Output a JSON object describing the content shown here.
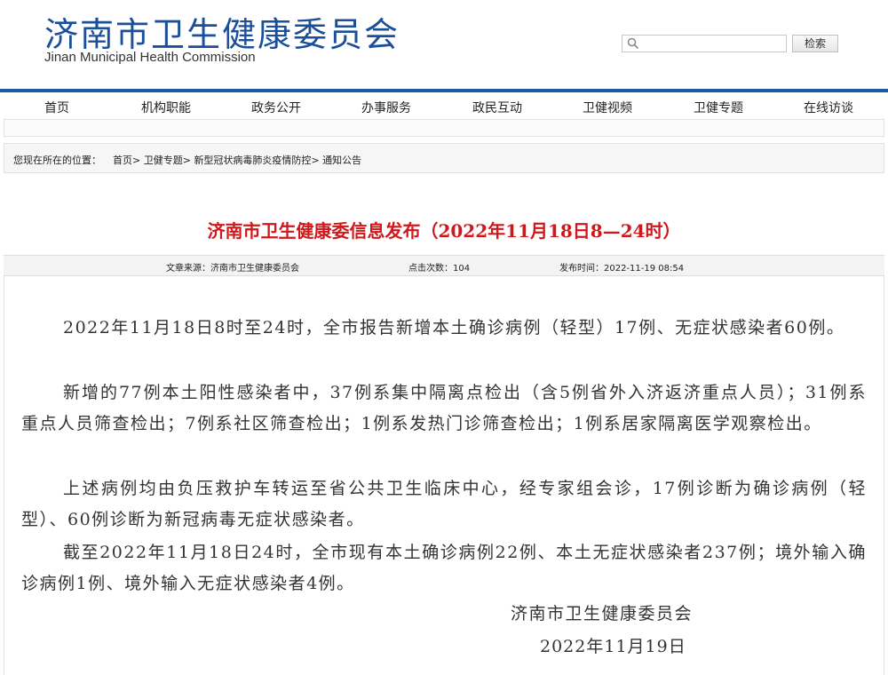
{
  "header": {
    "title": "济南市卫生健康委员会",
    "subtitle": "Jinan Municipal Health Commission",
    "search": {
      "placeholder": "",
      "button_label": "检索"
    }
  },
  "nav": {
    "items": [
      {
        "label": "首页"
      },
      {
        "label": "机构职能"
      },
      {
        "label": "政务公开"
      },
      {
        "label": "办事服务"
      },
      {
        "label": "政民互动"
      },
      {
        "label": "卫健视频"
      },
      {
        "label": "卫健专题"
      },
      {
        "label": "在线访谈"
      }
    ]
  },
  "breadcrumb": {
    "prefix": "您现在所在的位置：",
    "items": [
      "首页",
      "卫健专题",
      "新型冠状病毒肺炎疫情防控",
      "通知公告"
    ],
    "separator": ">"
  },
  "article": {
    "title": "济南市卫生健康委信息发布（2022年11月18日8—24时）",
    "meta": {
      "source_label": "文章来源：",
      "source": "济南市卫生健康委员会",
      "clicks_label": "点击次数：",
      "clicks": "104",
      "time_label": "发布时间：",
      "time": "2022-11-19 08:54"
    },
    "paragraphs": [
      "2022年11月18日8时至24时，全市报告新增本土确诊病例（轻型）17例、无症状感染者60例。",
      "新增的77例本土阳性感染者中，37例系集中隔离点检出（含5例省外入济返济重点人员）；31例系重点人员筛查检出；7例系社区筛查检出；1例系发热门诊筛查检出；1例系居家隔离医学观察检出。",
      "上述病例均由负压救护车转运至省公共卫生临床中心，经专家组会诊，17例诊断为确诊病例（轻型）、60例诊断为新冠病毒无症状感染者。",
      "截至2022年11月18日24时，全市现有本土确诊病例22例、本土无症状感染者237例；境外输入确诊病例1例、境外输入无症状感染者4例。"
    ],
    "signature": {
      "org": "济南市卫生健康委员会",
      "date": "2022年11月19日"
    }
  }
}
